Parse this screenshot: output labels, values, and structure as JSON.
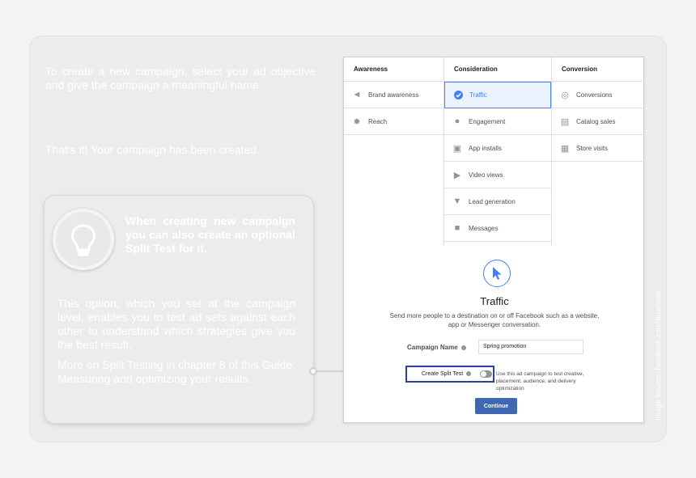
{
  "slide": {
    "intro_text": "To create a new campaign, select your ad objective and give the campaign a meaningful name.",
    "done_text": "That's it! Your campaign has been created.",
    "tip": {
      "head_pre": "When creating new campaign you can also create an optional ",
      "head_bold": "Split Test",
      "head_post": " for it.",
      "body_1": "This option, which you set at the campaign level, enables you to test ad sets against each other to understand which strategies give you the best result.",
      "body_2": "More on Split Testing  in chapter 8 of this Guide: Measuring and optimizing your results."
    },
    "image_credit": "Image source: facebook.com/business"
  },
  "screenshot": {
    "columns": [
      {
        "header": "Awareness",
        "items": [
          {
            "label": "Brand awareness",
            "icon": "megaphone-icon"
          },
          {
            "label": "Reach",
            "icon": "reach-icon"
          }
        ]
      },
      {
        "header": "Consideration",
        "items": [
          {
            "label": "Traffic",
            "icon": "check-circle-icon",
            "selected": true
          },
          {
            "label": "Engagement",
            "icon": "people-icon"
          },
          {
            "label": "App installs",
            "icon": "box-icon"
          },
          {
            "label": "Video views",
            "icon": "video-icon"
          },
          {
            "label": "Lead generation",
            "icon": "funnel-icon"
          },
          {
            "label": "Messages",
            "icon": "chat-icon"
          }
        ]
      },
      {
        "header": "Conversion",
        "items": [
          {
            "label": "Conversions",
            "icon": "globe-icon"
          },
          {
            "label": "Catalog sales",
            "icon": "cart-icon"
          },
          {
            "label": "Store visits",
            "icon": "store-icon"
          }
        ]
      }
    ],
    "objective_title": "Traffic",
    "objective_desc": "Send more people to a destination on or off Facebook such as a website, app or Messenger conversation.",
    "campaign_name_label": "Campaign Name",
    "campaign_name_value": "Spring promotion",
    "split_test_label": "Create Split Test",
    "split_test_on": false,
    "split_test_desc": "Use this ad campaign to test creative, placement, audience, and delivery optimization",
    "continue_label": "Continue",
    "accent_color": "#4080ff",
    "button_color": "#4267b2",
    "highlight_color": "#2d3fa3"
  }
}
